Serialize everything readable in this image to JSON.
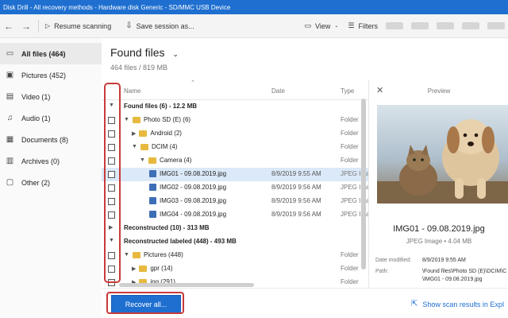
{
  "window": {
    "title": "Disk Drill - All recovery methods - Hardware disk Generic - SD/MMC USB Device"
  },
  "toolbar": {
    "back_icon": "arrow-left-icon",
    "forward_icon": "arrow-right-icon",
    "resume_label": "Resume scanning",
    "save_label": "Save session as...",
    "view_label": "View",
    "filters_label": "Filters"
  },
  "sidebar": {
    "items": [
      {
        "label": "All files (464)",
        "icon": "file-icon"
      },
      {
        "label": "Pictures (452)",
        "icon": "picture-icon"
      },
      {
        "label": "Video (1)",
        "icon": "video-icon"
      },
      {
        "label": "Audio (1)",
        "icon": "music-icon"
      },
      {
        "label": "Documents (8)",
        "icon": "document-icon"
      },
      {
        "label": "Archives (0)",
        "icon": "archive-icon"
      },
      {
        "label": "Other (2)",
        "icon": "other-icon"
      }
    ]
  },
  "main": {
    "title": "Found files",
    "subtitle": "464 files / 819 MB",
    "columns": {
      "name": "Name",
      "date": "Date",
      "type": "Type"
    },
    "rows": [
      {
        "name": "Found files (6) - 12.2 MB",
        "date": "",
        "type": ""
      },
      {
        "name": "Photo SD (E) (6)",
        "date": "",
        "type": "Folder"
      },
      {
        "name": "Android (2)",
        "date": "",
        "type": "Folder"
      },
      {
        "name": "DCIM (4)",
        "date": "",
        "type": "Folder"
      },
      {
        "name": "Camera (4)",
        "date": "",
        "type": "Folder"
      },
      {
        "name": "IMG01 - 09.08.2019.jpg",
        "date": "8/9/2019 9:55 AM",
        "type": "JPEG Ima"
      },
      {
        "name": "IMG02 - 09.08.2019.jpg",
        "date": "8/9/2019 9:56 AM",
        "type": "JPEG Ima"
      },
      {
        "name": "IMG03 - 09.08.2019.jpg",
        "date": "8/9/2019 9:56 AM",
        "type": "JPEG Ima"
      },
      {
        "name": "IMG04 - 09.08.2019.jpg",
        "date": "8/9/2019 9:56 AM",
        "type": "JPEG Ima"
      },
      {
        "name": "Reconstructed (10) - 313 MB",
        "date": "",
        "type": ""
      },
      {
        "name": "Reconstructed labeled (448) - 493 MB",
        "date": "",
        "type": ""
      },
      {
        "name": "Pictures (448)",
        "date": "",
        "type": "Folder"
      },
      {
        "name": "gpr (14)",
        "date": "",
        "type": "Folder"
      },
      {
        "name": "jpg (291)",
        "date": "",
        "type": "Folder"
      }
    ]
  },
  "preview": {
    "title": "Preview",
    "file_name": "IMG01 - 09.08.2019.jpg",
    "file_type": "JPEG Image • 4.04 MB",
    "date_modified_label": "Date modified:",
    "date_modified": "8/9/2019 9:55 AM",
    "path_label": "Path:",
    "path_line1": "\\Found files\\Photo SD (E)\\DCIM\\C",
    "path_line2": "\\IMG01 - 09.08.2019.jpg"
  },
  "footer": {
    "recover_label": "Recover all...",
    "scan_results_label": "Show scan results in Expl"
  }
}
